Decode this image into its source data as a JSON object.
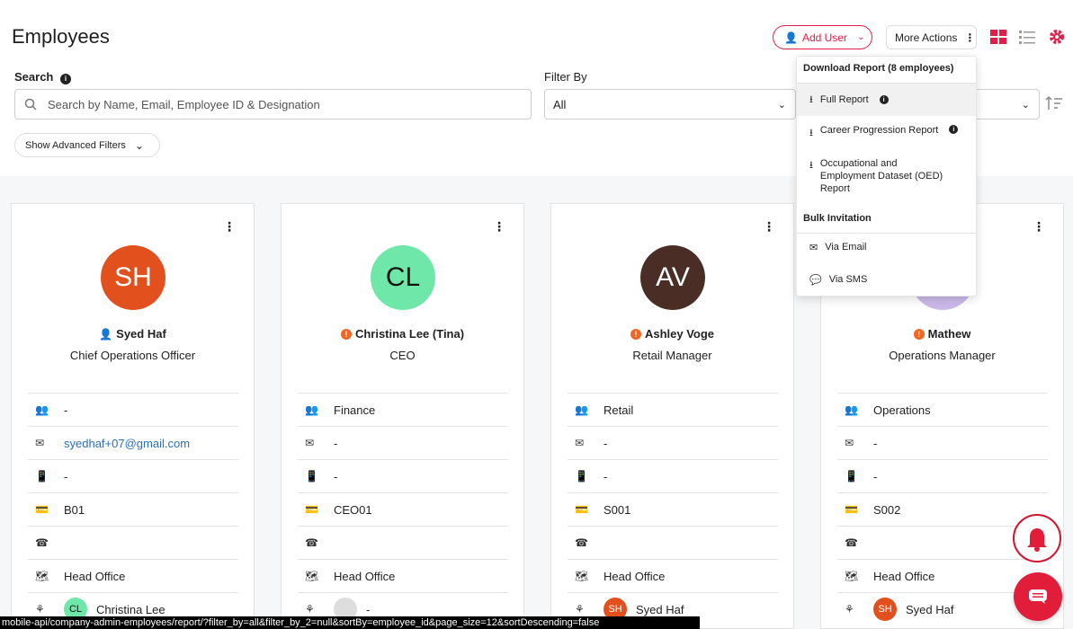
{
  "page": {
    "title": "Employees"
  },
  "header": {
    "add_user": "Add User",
    "more_actions": "More Actions"
  },
  "search": {
    "label": "Search",
    "placeholder": "Search by Name, Email, Employee ID & Designation"
  },
  "filter": {
    "label": "Filter By",
    "value": "All"
  },
  "advanced": {
    "label": "Show Advanced Filters"
  },
  "dropdown": {
    "section1": "Download Report (8 employees)",
    "full_report": "Full Report",
    "career": "Career Progression Report",
    "oed_1": "Occupational and",
    "oed_2": "Employment Dataset (OED)",
    "oed_3": "Report",
    "section2": "Bulk Invitation",
    "email": "Via Email",
    "sms": "Via SMS"
  },
  "cards": [
    {
      "initials": "SH",
      "color": "#e2501e",
      "name": "Syed Haf",
      "role": "Chief Operations Officer",
      "dept": "-",
      "email": "syedhaf+07@gmail.com",
      "phone": "-",
      "id": "B01",
      "tel": "",
      "location": "Head Office",
      "manager": "Christina Lee",
      "manager_initials": "CL"
    },
    {
      "initials": "CL",
      "color": "#6ee7a8",
      "name": "Christina Lee (Tina)",
      "role": "CEO",
      "dept": "Finance",
      "email": "-",
      "phone": "-",
      "id": "CEO01",
      "tel": "",
      "location": "Head Office",
      "manager": "-",
      "manager_initials": ""
    },
    {
      "initials": "AV",
      "color": "#4a2e25",
      "name": "Ashley Voge",
      "role": "Retail Manager",
      "dept": "Retail",
      "email": "-",
      "phone": "-",
      "id": "S001",
      "tel": "",
      "location": "Head Office",
      "manager": "Syed Haf",
      "manager_initials": "SH"
    },
    {
      "initials": "",
      "color": "#c9b8e8",
      "name": "Mathew",
      "role": "Operations Manager",
      "dept": "Operations",
      "email": "-",
      "phone": "-",
      "id": "S002",
      "tel": "",
      "location": "Head Office",
      "manager": "Syed Haf",
      "manager_initials": "SH"
    }
  ],
  "statusbar": {
    "url": "mobile-api/company-admin-employees/report/?filter_by=all&filter_by_2=null&sortBy=employee_id&page_size=12&sortDescending=false"
  }
}
